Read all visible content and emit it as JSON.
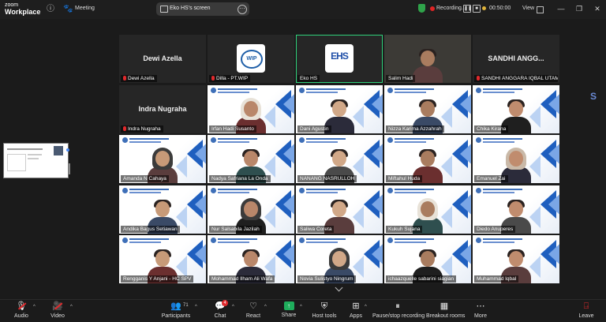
{
  "app": {
    "brand_line1": "zoom",
    "brand_line2": "Workplace",
    "meeting_label": "Meeting"
  },
  "screen_share": {
    "label": "Eko HS's screen"
  },
  "recording": {
    "label": "Recording..."
  },
  "timer": "00:50:00",
  "view_label": "View",
  "tiles": [
    {
      "id": "t1",
      "name": "Dewi Azella",
      "display": "Dewi Azella",
      "kind": "name",
      "muted": true
    },
    {
      "id": "t2",
      "name": "Dilla - PT.WIP",
      "kind": "logo",
      "logo": "WIP",
      "muted": true
    },
    {
      "id": "t3",
      "name": "Eko HS",
      "kind": "logo",
      "logo": "EHS",
      "muted": false,
      "active": true
    },
    {
      "id": "t4",
      "name": "Salim Hadi",
      "kind": "camera",
      "muted": false
    },
    {
      "id": "t5",
      "name": "SANDHI ANGGARA IQBAL UTAMA...",
      "display": "SANDHI ANGG...",
      "kind": "name",
      "muted": true
    },
    {
      "id": "t6",
      "name": "Indra Nugraha",
      "display": "Indra Nugraha",
      "kind": "name",
      "muted": true
    },
    {
      "id": "t7",
      "name": "Irfan Hadi Susanto",
      "kind": "bg",
      "muted": false
    },
    {
      "id": "t8",
      "name": "Dani Agustin",
      "kind": "bg",
      "muted": false
    },
    {
      "id": "t9",
      "name": "Nizza Karima Azzahrah",
      "kind": "bg",
      "muted": false
    },
    {
      "id": "t10",
      "name": "Chika Kirana",
      "kind": "bg",
      "muted": false
    },
    {
      "id": "t11",
      "name": "Amanda N Cahaya",
      "kind": "bg",
      "muted": false
    },
    {
      "id": "t12",
      "name": "Nadya Safriana La Onda",
      "kind": "bg",
      "muted": false
    },
    {
      "id": "t13",
      "name": "NANANG NASRULLOH",
      "kind": "bg",
      "muted": false
    },
    {
      "id": "t14",
      "name": "Miftahul Huda",
      "kind": "bg",
      "muted": false
    },
    {
      "id": "t15",
      "name": "Emanuel Zai",
      "kind": "bg",
      "muted": false
    },
    {
      "id": "t16",
      "name": "Andika Bagus Setiawan",
      "kind": "bg",
      "muted": false
    },
    {
      "id": "t17",
      "name": "Nur Salsabila Jazilah",
      "kind": "bg",
      "muted": false
    },
    {
      "id": "t18",
      "name": "Saliwa Coreta",
      "kind": "bg",
      "muted": false
    },
    {
      "id": "t19",
      "name": "Kukuh Sujana",
      "kind": "bg",
      "muted": false
    },
    {
      "id": "t20",
      "name": "Diedo Anuperes",
      "kind": "bg",
      "muted": false
    },
    {
      "id": "t21",
      "name": "Rengganis Y Anjani - HC SPV",
      "kind": "bg",
      "muted": false
    },
    {
      "id": "t22",
      "name": "Mohammad Ilham Ali Wafa",
      "kind": "bg",
      "muted": false
    },
    {
      "id": "t23",
      "name": "Novia Sulistyo Ningrum",
      "kind": "bg",
      "muted": false
    },
    {
      "id": "t24",
      "name": "ichaazquelle sabarini siagian",
      "kind": "bg",
      "muted": false
    },
    {
      "id": "t25",
      "name": "Muhammad Iqbal",
      "kind": "bg",
      "muted": false
    }
  ],
  "toolbar": {
    "audio": "Audio",
    "video": "Video",
    "participants": "Participants",
    "participants_count": "71",
    "chat": "Chat",
    "chat_badge": "4",
    "react": "React",
    "share": "Share",
    "host_tools": "Host tools",
    "apps": "Apps",
    "pause_record": "Pause/stop recording",
    "breakout": "Breakout rooms",
    "more": "More",
    "leave": "Leave"
  }
}
